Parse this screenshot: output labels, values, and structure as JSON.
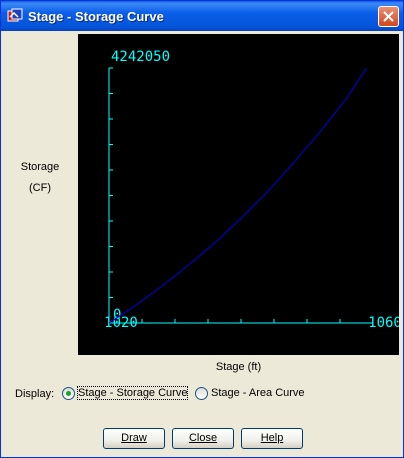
{
  "window": {
    "title": "Stage - Storage Curve"
  },
  "ylabel": {
    "line1": "Storage",
    "line2": "(CF)"
  },
  "xlabel": "Stage (ft)",
  "display": {
    "label": "Display:",
    "options": [
      {
        "label": "Stage - Storage Curve",
        "selected": true
      },
      {
        "label": "Stage - Area Curve",
        "selected": false
      }
    ]
  },
  "buttons": {
    "draw": "Draw",
    "close": "Close",
    "help": "Help"
  },
  "colors": {
    "axis": "#00ffff",
    "curve": "#0000c0",
    "background": "#000000"
  },
  "chart_data": {
    "type": "line",
    "title": "",
    "xlabel": "Stage (ft)",
    "ylabel": "Storage (CF)",
    "xlim": [
      1020,
      1060
    ],
    "ylim": [
      0,
      4242050
    ],
    "x_tick_labels": [
      "1020",
      "1060"
    ],
    "y_tick_labels": [
      "0",
      "4242050"
    ],
    "series": [
      {
        "x": [
          1020,
          1024,
          1028,
          1032,
          1036,
          1040,
          1044,
          1048,
          1052,
          1056,
          1059
        ],
        "y": [
          0,
          290000,
          610000,
          960000,
          1330000,
          1740000,
          2180000,
          2670000,
          3180000,
          3740000,
          4242050
        ]
      }
    ],
    "grid": false
  }
}
